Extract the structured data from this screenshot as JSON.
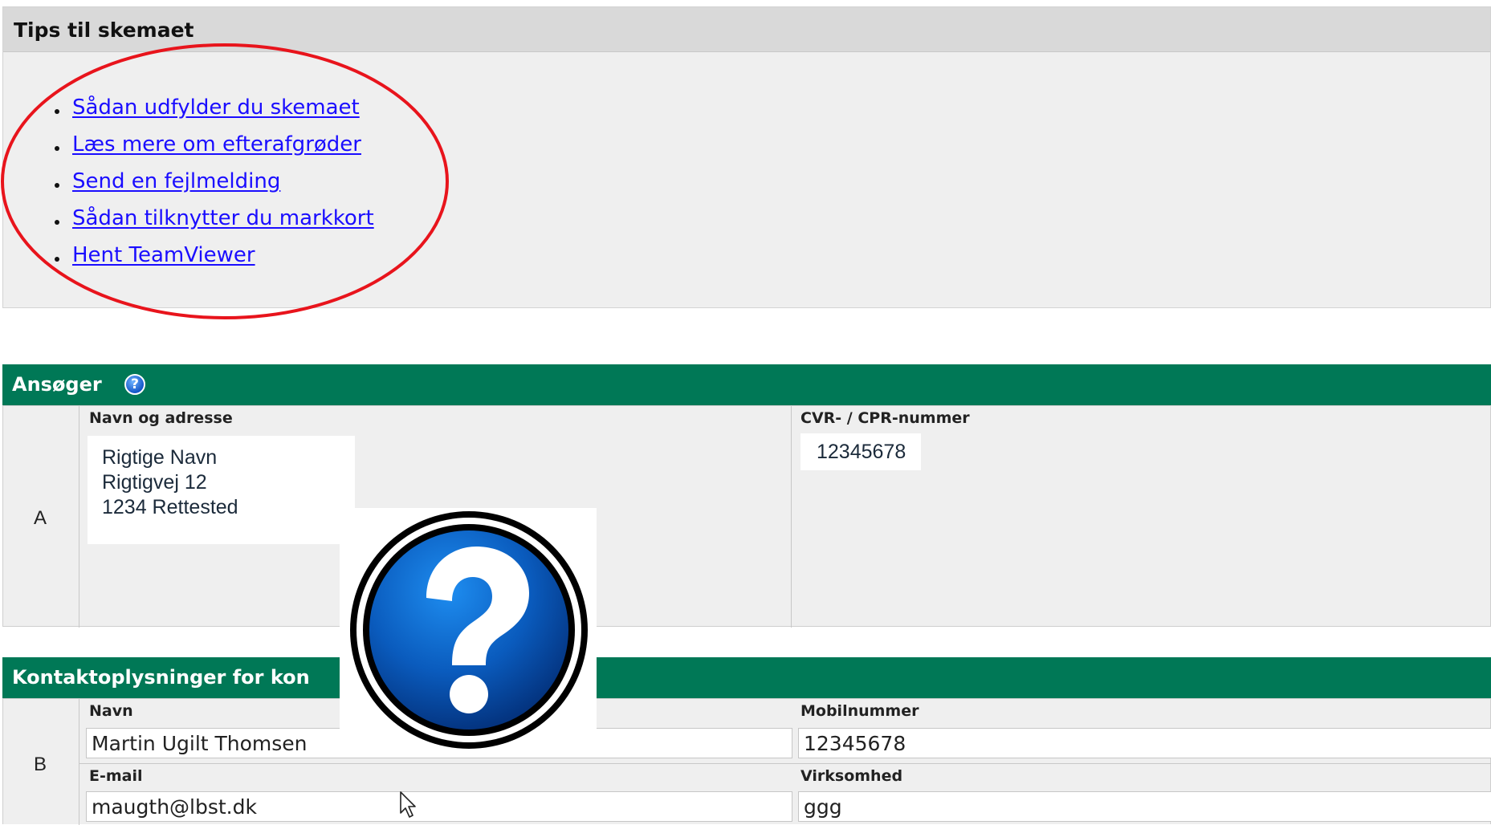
{
  "tips": {
    "title": "Tips til skemaet",
    "links": [
      "Sådan udfylder du skemaet",
      "Læs mere om efterafgrøder",
      "Send en fejlmelding",
      "Sådan tilknytter du markkort",
      "Hent TeamViewer"
    ]
  },
  "ansoeger": {
    "title": "Ansøger",
    "row_letter": "A",
    "name_address_label": "Navn og adresse",
    "address_lines": [
      "Rigtige Navn",
      "Rigtigvej 12",
      "1234 Rettested"
    ],
    "cvr_label": "CVR- / CPR-nummer",
    "cvr_value": "12345678"
  },
  "kontakt": {
    "title": "Kontaktoplysninger for kon",
    "row_letter": "B",
    "navn_label": "Navn",
    "navn_value": "Martin Ugilt Thomsen",
    "mobil_label": "Mobilnummer",
    "mobil_value": "12345678",
    "email_label": "E-mail",
    "email_value": "maugth@lbst.dk",
    "virksomhed_label": "Virksomhed",
    "virksomhed_value": "ggg"
  },
  "colors": {
    "section_bar": "#007856",
    "link": "#1a0dff",
    "annotation": "#e8141c"
  },
  "icons": [
    "help-icon",
    "question-mark-icon",
    "mouse-cursor-icon"
  ]
}
